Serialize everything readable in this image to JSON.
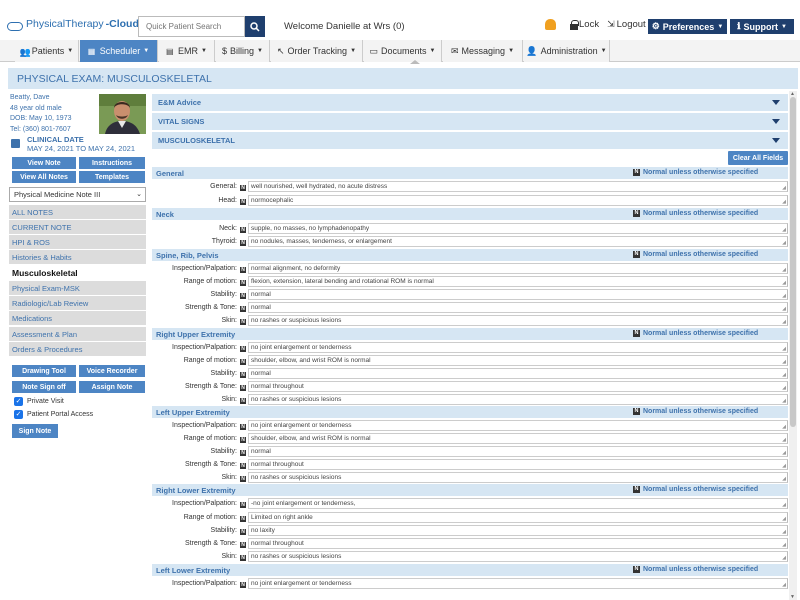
{
  "header": {
    "logo_brand": "PhysicalTherapy",
    "logo_suffix": "-Cloud",
    "search_placeholder": "Quick Patient Search",
    "welcome": "Welcome Danielle at Wrs (0)",
    "lock_label": "Lock",
    "logout_label": "Logout",
    "preferences_label": "Preferences",
    "support_label": "Support"
  },
  "nav": {
    "tabs": [
      {
        "label": "Patients"
      },
      {
        "label": "Scheduler"
      },
      {
        "label": "EMR"
      },
      {
        "label": "Billing"
      },
      {
        "label": "Order Tracking"
      },
      {
        "label": "Documents"
      },
      {
        "label": "Messaging"
      },
      {
        "label": "Administration"
      }
    ]
  },
  "page_title": "PHYSICAL EXAM: MUSCULOSKELETAL",
  "patient": {
    "name": "Beatty, Dave",
    "age_sex": "48 year old male",
    "dob": "DOB: May 10, 1973",
    "tel": "Tel: (360) 801-7607",
    "clinical_date_label": "CLINICAL DATE",
    "clinical_date_range": "MAY 24, 2021 TO MAY 24, 2021"
  },
  "left_buttons": {
    "view_note": "View Note",
    "instructions": "Instructions",
    "view_all_notes": "View All Notes",
    "templates": "Templates"
  },
  "note_select": "Physical Medicine Note III",
  "menu": [
    {
      "label": "ALL NOTES"
    },
    {
      "label": "CURRENT NOTE"
    },
    {
      "label": "HPI & ROS"
    },
    {
      "label": "Histories & Habits"
    },
    {
      "label": "Musculoskeletal"
    },
    {
      "label": "Physical Exam-MSK"
    },
    {
      "label": "Radiologic/Lab Review"
    },
    {
      "label": "Medications"
    },
    {
      "label": "Assessment & Plan"
    },
    {
      "label": "Orders & Procedures"
    }
  ],
  "bottom_buttons": {
    "drawing_tool": "Drawing Tool",
    "voice_recorder": "Voice Recorder",
    "note_sign_off": "Note Sign off",
    "assign_note": "Assign Note",
    "sign_note": "Sign Note"
  },
  "checkboxes": {
    "private_visit": "Private Visit",
    "patient_portal_access": "Patient Portal Access"
  },
  "accordions": {
    "em_advice": "E&M Advice",
    "vital_signs": "VITAL SIGNS",
    "musculoskeletal": "MUSCULOSKELETAL"
  },
  "clear_all_fields": "Clear All Fields",
  "normal_label": "Normal unless otherwise specified",
  "sections": {
    "general": {
      "title": "General",
      "general_label": "General:",
      "general_value": "well nourished, well hydrated, no acute distress",
      "head_label": "Head:",
      "head_value": "normocephalic"
    },
    "neck": {
      "title": "Neck",
      "neck_label": "Neck:",
      "neck_value": "supple, no masses, no lymphadenopathy",
      "thyroid_label": "Thyroid:",
      "thyroid_value": "no nodules, masses, tenderness, or enlargement"
    },
    "spine": {
      "title": "Spine, Rib, Pelvis",
      "insp_label": "Inspection/Palpation:",
      "insp_value": "normal alignment, no deformity",
      "rom_label": "Range of motion:",
      "rom_value": "flexion, extension, lateral bending and rotational ROM is normal",
      "stab_label": "Stability:",
      "stab_value": "normal",
      "str_label": "Strength & Tone:",
      "str_value": "normal",
      "skin_label": "Skin:",
      "skin_value": "no rashes or suspicious lesions"
    },
    "rue": {
      "title": "Right Upper Extremity",
      "insp_label": "Inspection/Palpation:",
      "insp_value": "no joint enlargement or tenderness",
      "rom_label": "Range of motion:",
      "rom_value": "shoulder, elbow, and wrist ROM is normal",
      "stab_label": "Stability:",
      "stab_value": "normal",
      "str_label": "Strength & Tone:",
      "str_value": "normal throughout",
      "skin_label": "Skin:",
      "skin_value": "no rashes or suspicious lesions"
    },
    "lue": {
      "title": "Left Upper Extremity",
      "insp_label": "Inspection/Palpation:",
      "insp_value": "no joint enlargement or tenderness",
      "rom_label": "Range of motion:",
      "rom_value": "shoulder, elbow, and wrist ROM is normal",
      "stab_label": "Stability:",
      "stab_value": "normal",
      "str_label": "Strength & Tone:",
      "str_value": "normal throughout",
      "skin_label": "Skin:",
      "skin_value": "no rashes or suspicious lesions"
    },
    "rle": {
      "title": "Right Lower Extremity",
      "insp_label": "Inspection/Palpation:",
      "insp_value": "-no joint enlargement or tenderness,",
      "rom_label": "Range of motion:",
      "rom_value": "Limited on right ankle",
      "stab_label": "Stability:",
      "stab_value": "no laxity",
      "str_label": "Strength & Tone:",
      "str_value": "normal throughout",
      "skin_label": "Skin:",
      "skin_value": "no rashes or suspicious lesions"
    },
    "lle": {
      "title": "Left Lower Extremity",
      "insp_label": "Inspection/Palpation:",
      "insp_value": "no joint enlargement or tenderness"
    }
  },
  "colors": {
    "navy": "#1f3f6e",
    "accent_blue": "#4d85c4",
    "section_bg": "#d6e6f3",
    "link_blue": "#3e72ac"
  }
}
